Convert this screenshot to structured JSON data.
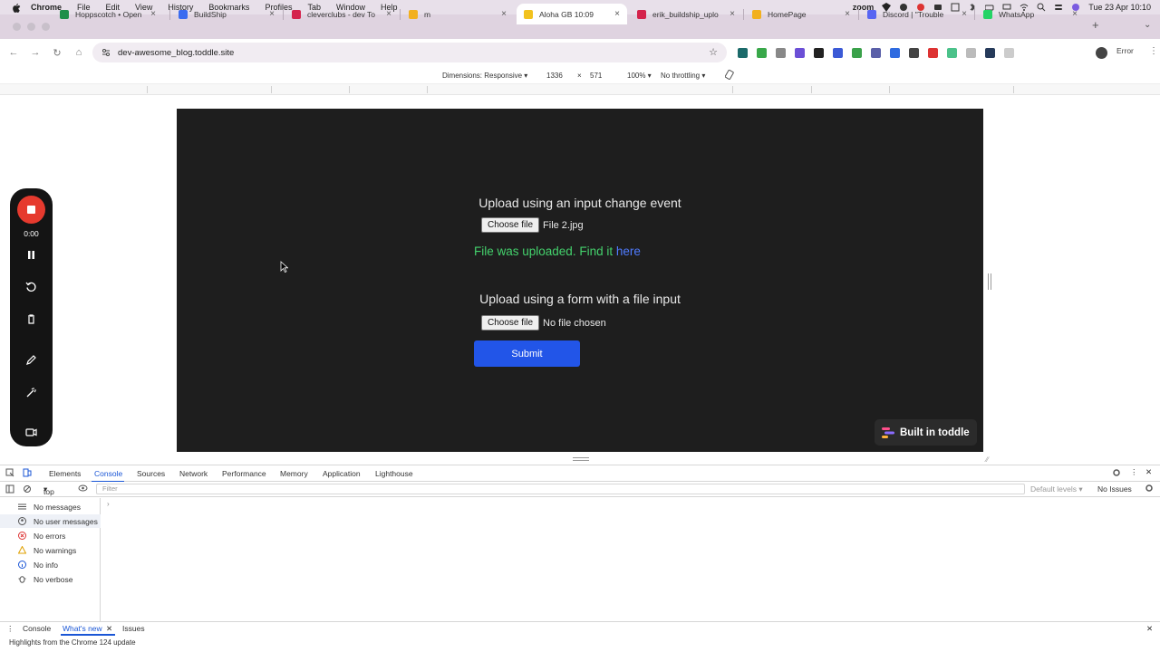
{
  "menubar": {
    "app": "Chrome",
    "items": [
      "File",
      "Edit",
      "View",
      "History",
      "Bookmarks",
      "Profiles",
      "Tab",
      "Window",
      "Help"
    ],
    "zoom_label": "zoom",
    "datetime": "Tue 23 Apr 10:10"
  },
  "tabs": [
    {
      "title": "Hoppscotch • Open",
      "color": "#1f8f4a"
    },
    {
      "title": "BuildShip",
      "color": "#3b6cf0"
    },
    {
      "title": "cleverclubs - dev To",
      "color": "#d4234c"
    },
    {
      "title": "m",
      "color": "#f2b01e"
    },
    {
      "title": "Aloha GB 10:09",
      "color": "#f2c21e",
      "active": true
    },
    {
      "title": "erik_buildship_uplo",
      "color": "#d4234c"
    },
    {
      "title": "HomePage",
      "color": "#f2b01e"
    },
    {
      "title": "Discord | \"Trouble",
      "color": "#5865f2"
    },
    {
      "title": "WhatsApp",
      "color": "#25d366"
    }
  ],
  "address": {
    "url": "dev-awesome_blog.toddle.site",
    "status_pill": "Error"
  },
  "device_toolbar": {
    "dimensions_label": "Dimensions: Responsive ▾",
    "width": "1336",
    "times": "×",
    "height": "571",
    "zoom": "100% ▾",
    "throttling": "No throttling ▾"
  },
  "page": {
    "section1_title": "Upload using an input change event",
    "choose_file": "Choose file",
    "section1_filename": "File 2.jpg",
    "success_text": "File was uploaded. Find it ",
    "success_link": "here",
    "section2_title": "Upload using a form with a file input",
    "section2_filename": "No file chosen",
    "submit_label": "Submit",
    "badge": "Built in toddle"
  },
  "recorder": {
    "time": "0:00"
  },
  "devtools": {
    "tabs": [
      "Elements",
      "Console",
      "Sources",
      "Network",
      "Performance",
      "Memory",
      "Application",
      "Lighthouse"
    ],
    "active_tab": "Console",
    "context": "top",
    "filter_placeholder": "Filter",
    "levels": "Default levels ▾",
    "issues": "No Issues",
    "sidebar": [
      {
        "label": "No messages",
        "icon": "list-icon"
      },
      {
        "label": "No user messages",
        "icon": "user-icon",
        "selected": true
      },
      {
        "label": "No errors",
        "icon": "error-icon"
      },
      {
        "label": "No warnings",
        "icon": "warning-icon"
      },
      {
        "label": "No info",
        "icon": "info-icon"
      },
      {
        "label": "No verbose",
        "icon": "bug-icon"
      }
    ],
    "drawer_tabs": [
      "Console",
      "What's new",
      "Issues"
    ],
    "drawer_active": "What's new",
    "highlights": "Highlights from the Chrome 124 update"
  },
  "colors": {
    "page_bg": "#1e1e1e",
    "success": "#44d16c",
    "link": "#4f7bff",
    "submit": "#2255e8",
    "record": "#e63a2e"
  }
}
